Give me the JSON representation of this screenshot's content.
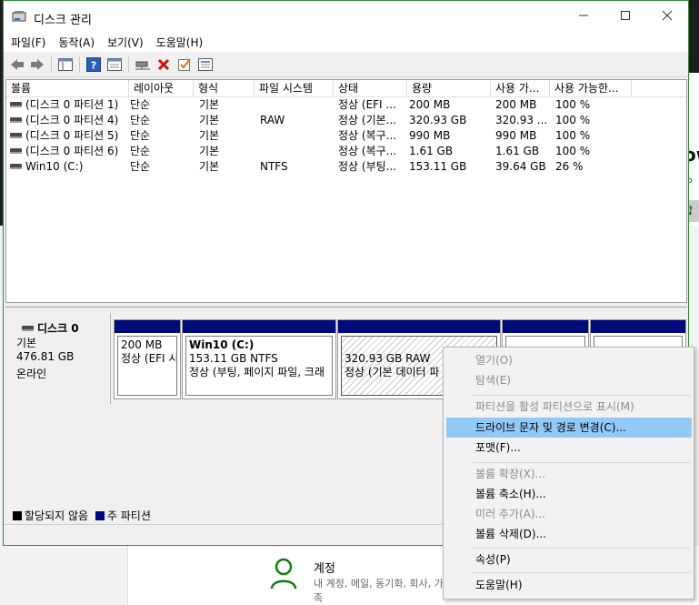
{
  "window": {
    "title": "디스크 관리"
  },
  "menubar": [
    {
      "label": "파일(F)"
    },
    {
      "label": "동작(A)"
    },
    {
      "label": "보기(V)"
    },
    {
      "label": "도움말(H)"
    }
  ],
  "toolbar": {
    "icons": [
      "back-arrow-icon",
      "forward-arrow-icon",
      "console-tree-icon",
      "help-icon",
      "properties-icon",
      "connect-icon",
      "delete-icon",
      "check-icon",
      "list-icon"
    ]
  },
  "volume_list": {
    "columns": [
      "볼륨",
      "레이아웃",
      "형식",
      "파일 시스템",
      "상태",
      "용량",
      "사용 가...",
      "사용 가능한..."
    ],
    "rows": [
      [
        "(디스크 0 파티션 1)",
        "단순",
        "기본",
        "",
        "정상 (EFI ...",
        "200 MB",
        "200 MB",
        "100 %"
      ],
      [
        "(디스크 0 파티션 4)",
        "단순",
        "기본",
        "RAW",
        "정상 (기본...",
        "320.93 GB",
        "320.93 ...",
        "100 %"
      ],
      [
        "(디스크 0 파티션 5)",
        "단순",
        "기본",
        "",
        "정상 (복구...",
        "990 MB",
        "990 MB",
        "100 %"
      ],
      [
        "(디스크 0 파티션 6)",
        "단순",
        "기본",
        "",
        "정상 (복구...",
        "1.61 GB",
        "1.61 GB",
        "100 %"
      ],
      [
        "Win10 (C:)",
        "단순",
        "기본",
        "NTFS",
        "정상 (부팅...",
        "153.11 GB",
        "39.64 GB",
        "26 %"
      ]
    ]
  },
  "disk": {
    "name": "디스크 0",
    "type": "기본",
    "size": "476.81 GB",
    "status": "온라인",
    "partitions": [
      {
        "title": "",
        "line1": "200 MB",
        "line2": "정상 (EFI 시"
      },
      {
        "title": "Win10  (C:)",
        "line1": "153.11 GB NTFS",
        "line2": "정상 (부팅, 페이지 파일, 크래"
      },
      {
        "title": "",
        "line1": "320.93 GB RAW",
        "line2": "정상 (기본 데이터 파"
      },
      {
        "title": "",
        "line1": "",
        "line2": ""
      },
      {
        "title": "",
        "line1": "",
        "line2": ""
      }
    ]
  },
  "legend": {
    "unallocated": "할당되지 않음",
    "primary": "주 파티션",
    "colors": {
      "unallocated": "#000000",
      "primary": "#000a7a"
    }
  },
  "context_menu": [
    {
      "label": "열기(O)",
      "disabled": true
    },
    {
      "label": "탐색(E)",
      "disabled": true
    },
    {
      "separator": true
    },
    {
      "label": "파티션을 활성 파티션으로 표시(M)",
      "disabled": true
    },
    {
      "label": "드라이브 문자 및 경로 변경(C)...",
      "highlighted": true
    },
    {
      "label": "포맷(F)..."
    },
    {
      "separator": true
    },
    {
      "label": "볼륨 확장(X)...",
      "disabled": true
    },
    {
      "label": "볼륨 축소(H)..."
    },
    {
      "label": "미러 추가(A)...",
      "disabled": true
    },
    {
      "label": "볼륨 삭제(D)..."
    },
    {
      "separator": true
    },
    {
      "label": "속성(P)"
    },
    {
      "separator": true
    },
    {
      "label": "도움말(H)"
    }
  ],
  "background": {
    "settings_title": "계정",
    "settings_desc": "내 계정, 메일, 동기화, 회사, 가족",
    "right_text": "ow",
    "right_small": "b",
    "right_button": "합"
  },
  "colors": {
    "window_border": "#2e8b3c",
    "highlight": "#91c9f7",
    "partition_bar": "#000a7a"
  }
}
